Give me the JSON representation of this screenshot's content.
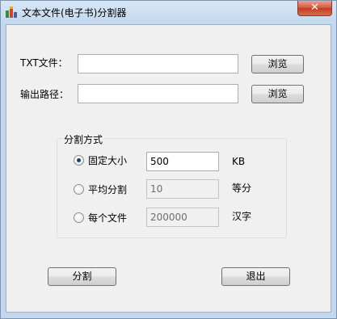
{
  "window": {
    "title": "文本文件(电子书)分割器",
    "close_label": "✕"
  },
  "form": {
    "txt_label": "TXT文件：",
    "txt_value": "",
    "txt_browse": "浏览",
    "out_label": "输出路径：",
    "out_value": "",
    "out_browse": "浏览"
  },
  "split_mode": {
    "title": "分割方式",
    "options": [
      {
        "label": "固定大小",
        "value": "500",
        "unit": "KB",
        "checked": true,
        "enabled": true
      },
      {
        "label": "平均分割",
        "value": "10",
        "unit": "等分",
        "checked": false,
        "enabled": false
      },
      {
        "label": "每个文件",
        "value": "200000",
        "unit": "汉字",
        "checked": false,
        "enabled": false
      }
    ]
  },
  "actions": {
    "split_label": "分割",
    "exit_label": "退出"
  },
  "colors": {
    "title_bar": "#c7dcef",
    "close_button": "#c8452a",
    "client_bg": "#f0f0f0"
  }
}
